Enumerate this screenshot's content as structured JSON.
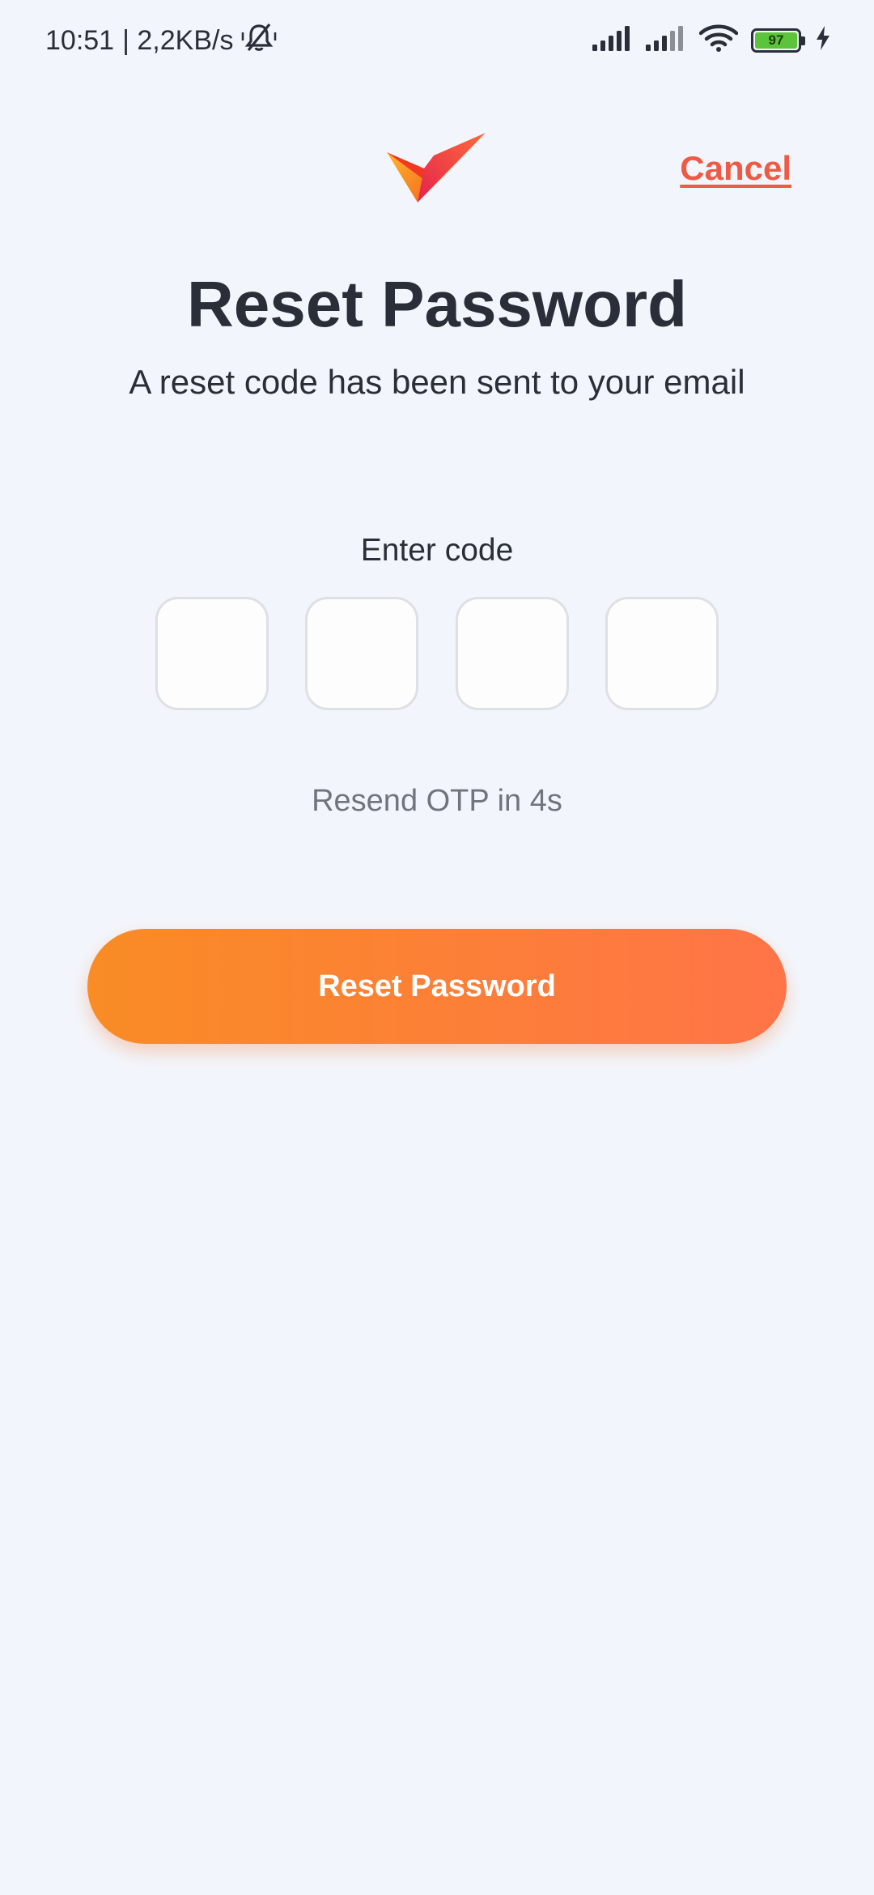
{
  "status_bar": {
    "time": "10:51",
    "network_speed": "| 2,2KB/s",
    "battery_level": "97",
    "icons": [
      "muted-bell-icon",
      "signal-icon",
      "signal-icon",
      "wifi-icon",
      "battery-icon",
      "charging-bolt-icon"
    ]
  },
  "header": {
    "logo_icon": "brand-checkmark-logo",
    "cancel_label": "Cancel"
  },
  "title": "Reset Password",
  "subtitle": "A reset code has been sent to your email",
  "code": {
    "label": "Enter code",
    "digits": [
      "",
      "",
      "",
      ""
    ]
  },
  "resend_text": "Resend OTP in 4s",
  "submit_label": "Reset Password",
  "colors": {
    "background": "#f2f6fc",
    "text": "#2a2e38",
    "accent_red": "#ef5a44",
    "button_gradient_start": "#f98c25",
    "button_gradient_end": "#ff7448",
    "muted_text": "#71747c",
    "battery_green": "#5cc43a"
  }
}
